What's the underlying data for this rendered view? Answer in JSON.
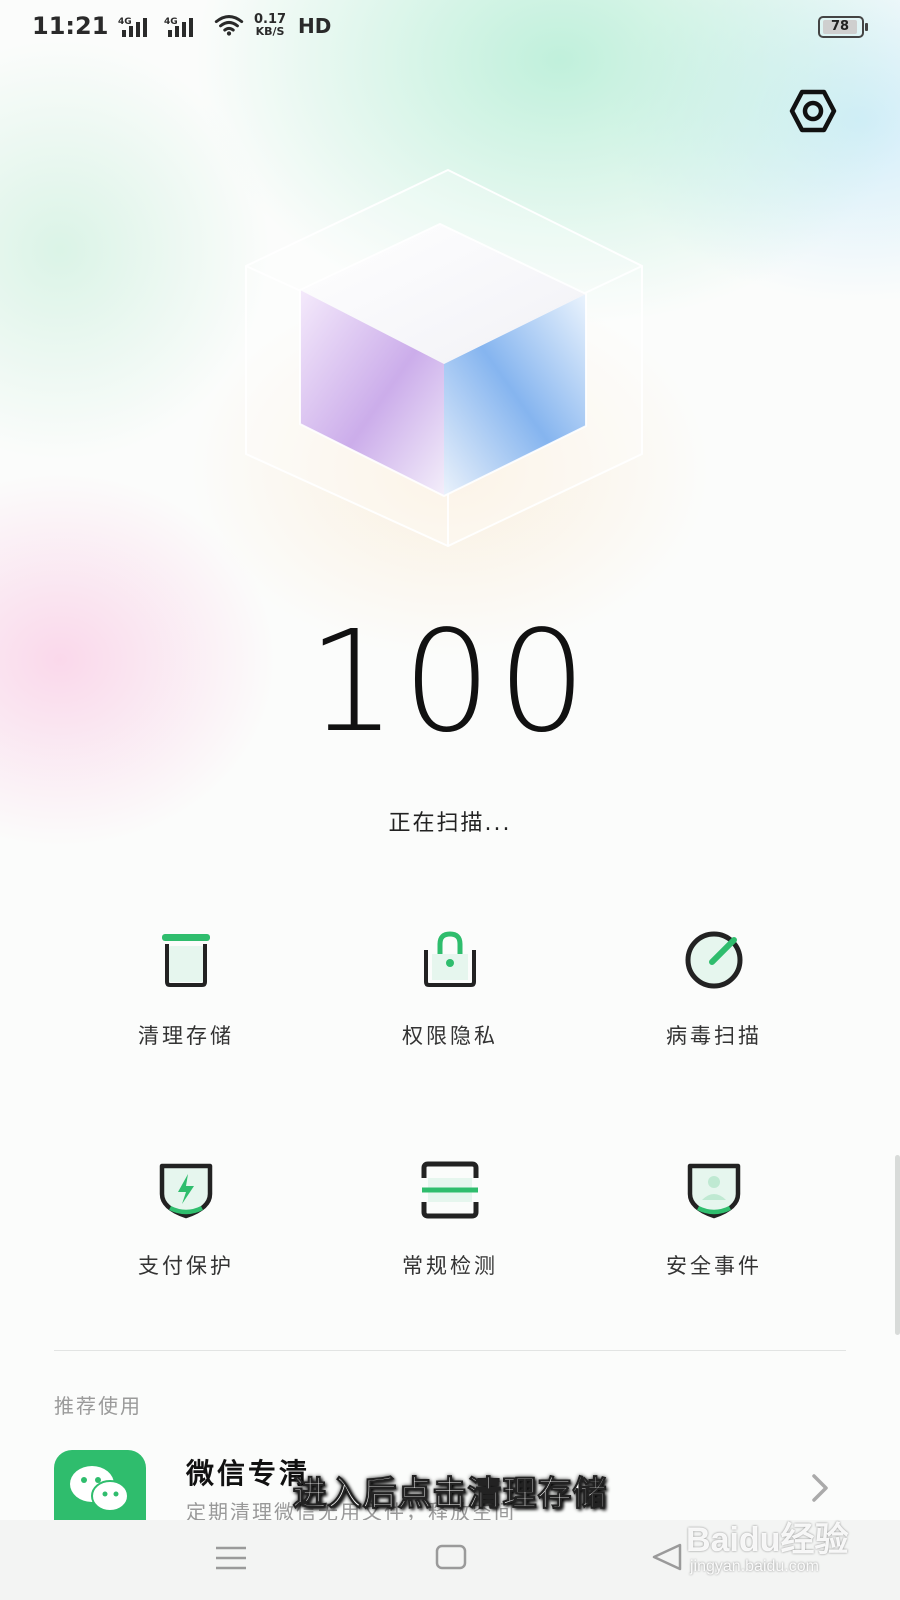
{
  "status_bar": {
    "time": "11:21",
    "signal1_type": "4G",
    "signal2_type": "4G",
    "net_speed_value": "0.17",
    "net_speed_unit": "KB/S",
    "hd_label": "HD",
    "battery_level": "78"
  },
  "header": {
    "settings_icon": "settings-gear-icon"
  },
  "score": {
    "value": "100",
    "status": "正在扫描..."
  },
  "tools": [
    {
      "label": "清理存储",
      "icon": "trash-bin-icon"
    },
    {
      "label": "权限隐私",
      "icon": "lock-bag-icon"
    },
    {
      "label": "病毒扫描",
      "icon": "radar-scan-icon"
    },
    {
      "label": "支付保护",
      "icon": "shield-bolt-icon"
    },
    {
      "label": "常规检测",
      "icon": "frame-scan-icon"
    },
    {
      "label": "安全事件",
      "icon": "shield-person-icon"
    }
  ],
  "recommend": {
    "title": "推荐使用",
    "items": [
      {
        "name": "微信专清",
        "desc": "定期清理微信无用文件，释放空间",
        "icon": "wechat-icon"
      }
    ]
  },
  "navbar": {
    "icons": [
      "menu-icon",
      "home-icon",
      "back-icon"
    ]
  },
  "overlay": {
    "caption": "进入后点击清理存储",
    "watermark_brand": "Baidu经验",
    "watermark_url": "jingyan.baidu.com"
  },
  "colors": {
    "accent": "#2fbd6d",
    "dark": "#333333",
    "background": "#fbfcfb"
  }
}
